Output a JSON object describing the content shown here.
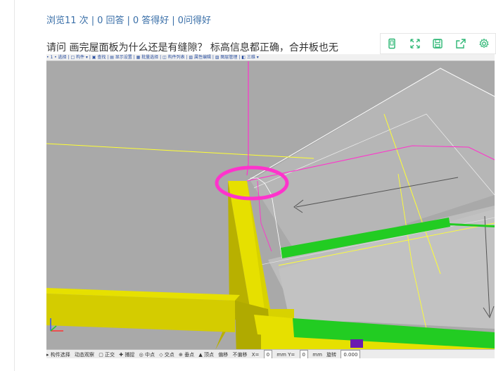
{
  "stats": {
    "views": "浏览11 次",
    "answers": "0 回答",
    "good_answers": "0 答得好",
    "good_questions": "0问得好"
  },
  "question": {
    "text": "请问  画完屋面板为什么还是有缝隙？ 标高信息都正确，合并板也无"
  },
  "toolbar": {
    "buttons": [
      "phone-icon",
      "fullscreen-icon",
      "save-icon",
      "share-icon",
      "settings-icon"
    ]
  },
  "cad": {
    "top_strip": "• 1 • 选择  |  □ 构件 ▾  |  ▣ 查找  |  ▤ 显示设置  |  ▦ 批量选择  |  ◫ 构件列表  |  ▧ 属性编辑  |  ▨ 图层管理  |  ◧ 三维 ▾",
    "bottom_strip": [
      "▸ 构件选择",
      "动态观察",
      "▢ 正交",
      "✚ 捕捉",
      "◎ 中点",
      "◇ 交点",
      "⊕ 垂点",
      "▲ 顶点",
      "偏移",
      "不偏移",
      "X=",
      "0",
      "mm Y=",
      "0",
      "mm",
      "旋转",
      "0.000"
    ],
    "colors": {
      "background": "#a9a9a9",
      "beam_yellow": "#e6e000",
      "slab_green": "#22cc22",
      "annotation_magenta": "#ff33cc",
      "axis_yellow": "#ffff33"
    }
  }
}
